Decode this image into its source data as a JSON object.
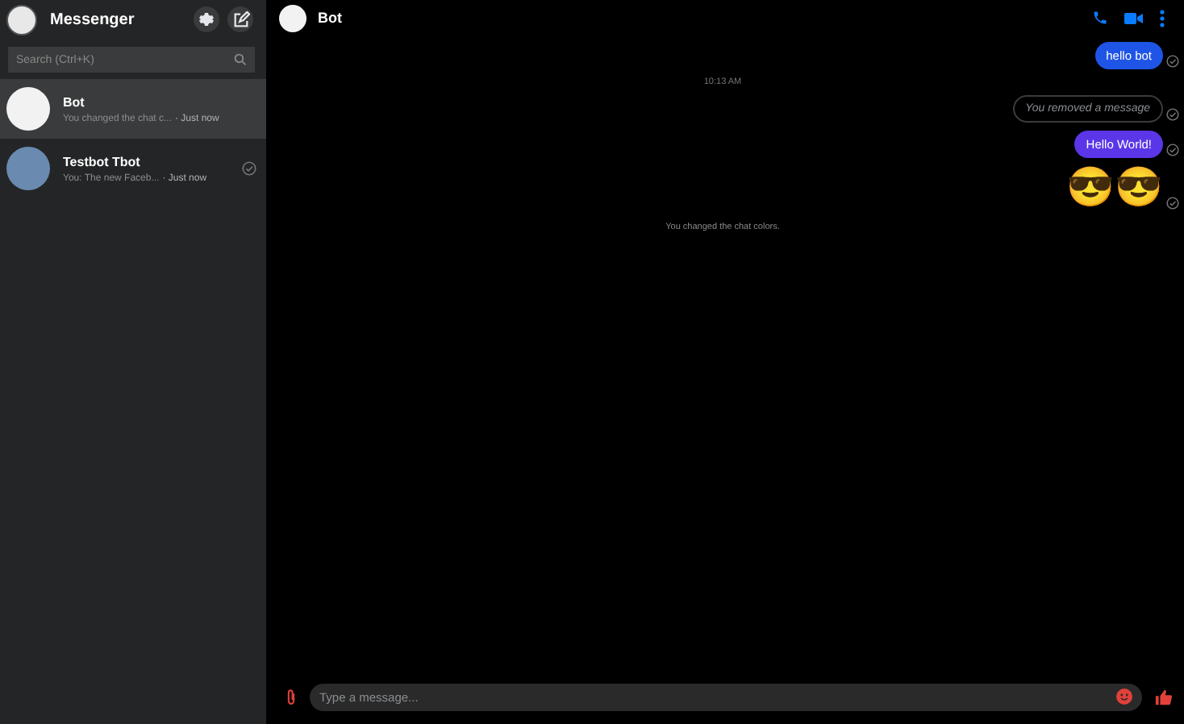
{
  "sidebar": {
    "title": "Messenger",
    "search": {
      "placeholder": "Search (Ctrl+K)"
    },
    "conversations": [
      {
        "name": "Bot",
        "preview": "You changed the chat c...",
        "time": "· Just now",
        "selected": true,
        "sent_receipt": false
      },
      {
        "name": "Testbot Tbot",
        "preview": "You: The new Faceb...",
        "time": "· Just now",
        "selected": false,
        "sent_receipt": true
      }
    ]
  },
  "chat": {
    "title": "Bot",
    "messages": [
      {
        "kind": "bubble",
        "text": "hello bot",
        "color": "#1f55e6"
      },
      {
        "kind": "timestamp",
        "text": "10:13 AM"
      },
      {
        "kind": "removed",
        "text": "You removed a message"
      },
      {
        "kind": "bubble",
        "text": "Hello World!",
        "color": "#5a36e8"
      },
      {
        "kind": "emoji",
        "text": "😎😎"
      },
      {
        "kind": "notice",
        "text": "You changed the chat colors."
      }
    ],
    "composer": {
      "placeholder": "Type a message..."
    }
  }
}
